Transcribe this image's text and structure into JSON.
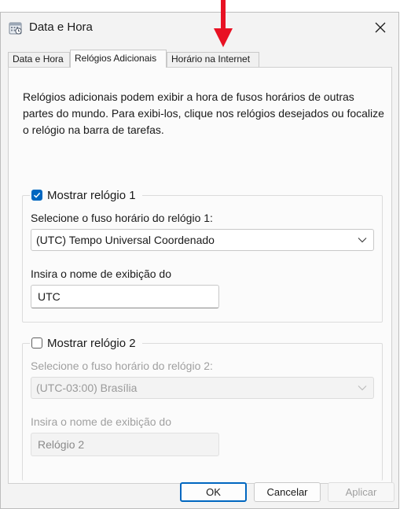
{
  "window": {
    "title": "Data e Hora",
    "app_icon": "calendar-clock-icon",
    "close_icon": "close-icon"
  },
  "tabs": [
    {
      "label": "Data e Hora",
      "active": false
    },
    {
      "label": "Relógios Adicionais",
      "active": true
    },
    {
      "label": "Horário na Internet",
      "active": false
    }
  ],
  "annotation": {
    "icon": "red-down-arrow",
    "color": "#e81123"
  },
  "description": "Relógios adicionais podem exibir a hora de fusos horários de outras partes do mundo. Para exibi-los, clique nos relógios desejados ou focalize o relógio na barra de tarefas.",
  "clock1": {
    "show_label": "Mostrar relógio 1",
    "checked": true,
    "timezone_label": "Selecione o fuso horário do relógio 1:",
    "timezone_value": "(UTC) Tempo Universal Coordenado",
    "display_name_label": "Insira o nome de exibição do",
    "display_name_value": "UTC"
  },
  "clock2": {
    "show_label": "Mostrar relógio 2",
    "checked": false,
    "timezone_label": "Selecione o fuso horário do relógio 2:",
    "timezone_value": "(UTC-03:00) Brasília",
    "display_name_label": "Insira o nome de exibição do",
    "display_name_value": "Relógio 2"
  },
  "buttons": {
    "ok": "OK",
    "cancel": "Cancelar",
    "apply": "Aplicar"
  },
  "colors": {
    "accent": "#0067c0",
    "dialog_bg": "#f3f3f3",
    "panel_bg": "#fbfbfb",
    "disabled_text": "#a0a0a0"
  }
}
